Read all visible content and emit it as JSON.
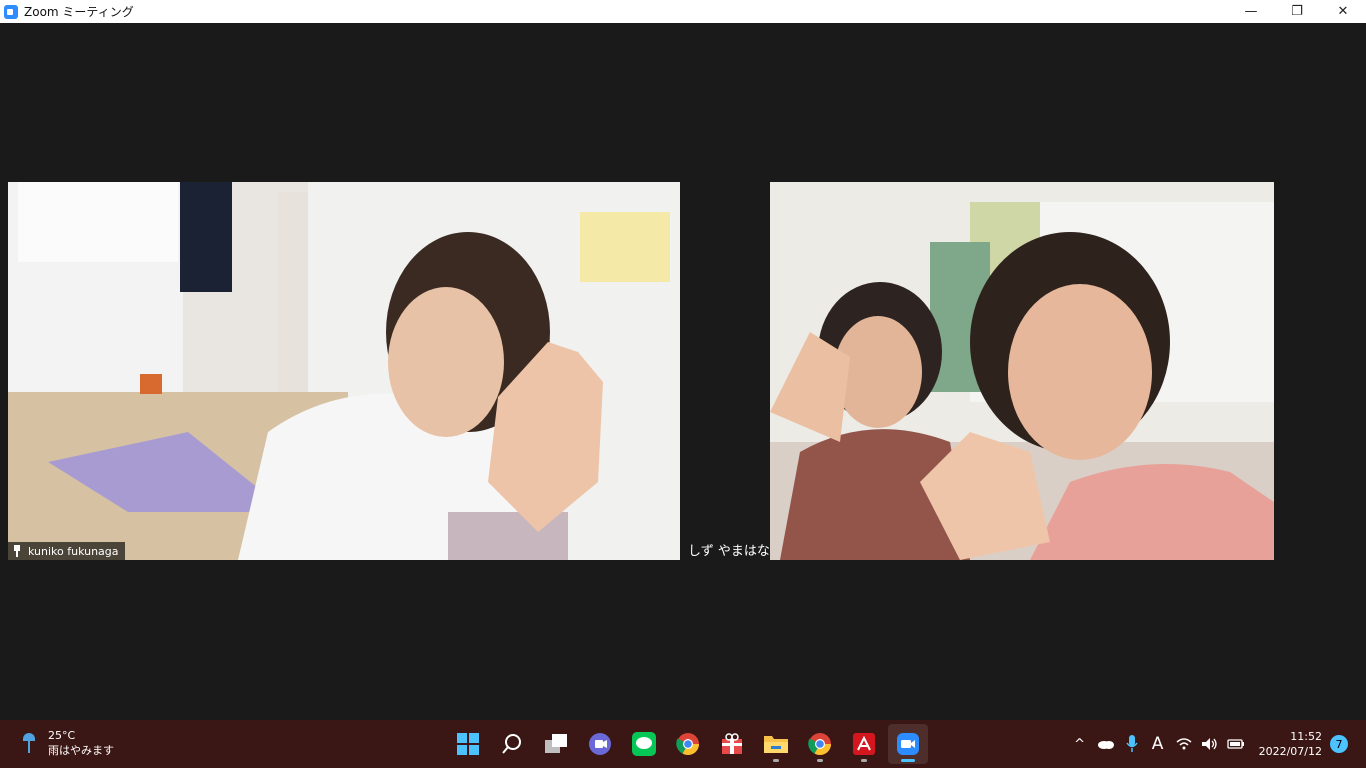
{
  "window": {
    "title": "Zoom ミーティング",
    "minimize": "—",
    "restore": "❐",
    "close": "✕"
  },
  "meeting": {
    "participants": [
      {
        "name": "kuniko fukunaga",
        "pinned": true
      },
      {
        "name": "しず やまはな"
      }
    ]
  },
  "taskbar": {
    "weather": {
      "temp": "25°C",
      "desc": "雨はやみます"
    },
    "apps": [
      "start",
      "search",
      "task-view",
      "teams-chat",
      "line",
      "chrome",
      "gift-app",
      "file-explorer",
      "chrome",
      "acrobat",
      "zoom"
    ],
    "tray": {
      "chevron": "^",
      "ime": "A"
    },
    "clock": {
      "time": "11:52",
      "date": "2022/07/12"
    },
    "notifications": "7"
  },
  "colors": {
    "meeting_bg": "#1a1a1a",
    "taskbar_bg": "#3a1714",
    "zoom_blue": "#2d8cff",
    "accent": "#4cc2ff"
  }
}
